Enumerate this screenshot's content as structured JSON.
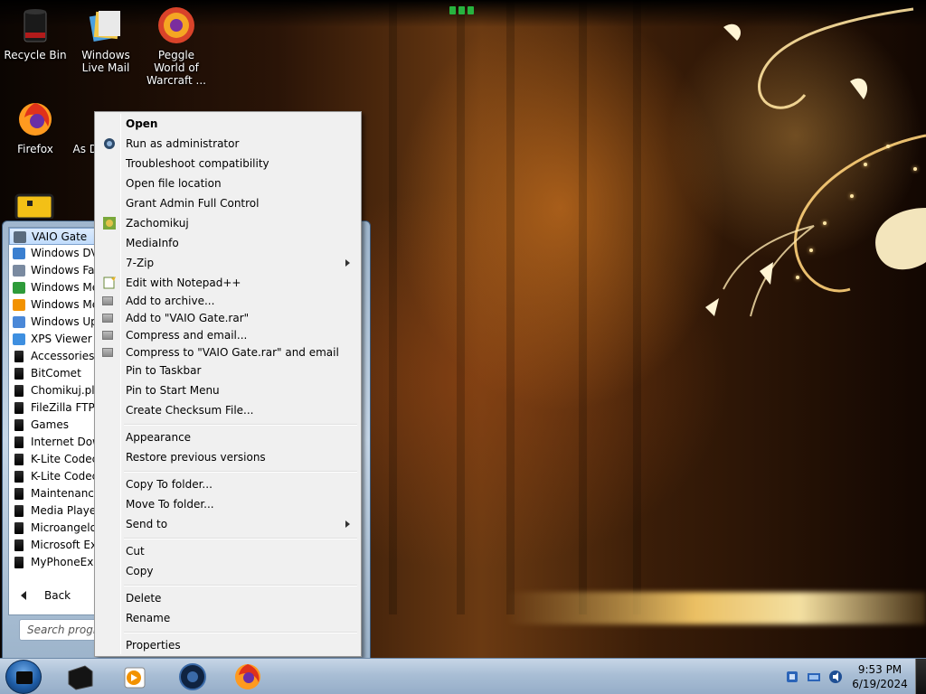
{
  "desktop": {
    "icons": [
      {
        "label": "Recycle Bin",
        "icon": "recycle-bin-icon"
      },
      {
        "label": "Windows Live Mail",
        "icon": "windows-live-mail-icon"
      },
      {
        "label": "Peggle World of Warcraft ...",
        "icon": "peggle-icon"
      },
      {
        "label": "Firefox",
        "icon": "firefox-icon"
      },
      {
        "label": "As D",
        "icon": "partial-icon"
      }
    ]
  },
  "start_menu": {
    "programs": [
      {
        "label": "VAIO Gate",
        "icon": "vaio-gate-icon",
        "selected": true
      },
      {
        "label": "Windows DVD",
        "icon": "windows-dvd-icon"
      },
      {
        "label": "Windows Fax",
        "icon": "windows-fax-icon"
      },
      {
        "label": "Windows Me",
        "icon": "windows-media-center-icon"
      },
      {
        "label": "Windows Me",
        "icon": "windows-media-player-icon"
      },
      {
        "label": "Windows Upo",
        "icon": "windows-update-icon"
      },
      {
        "label": "XPS Viewer",
        "icon": "xps-viewer-icon"
      },
      {
        "label": "Accessories",
        "icon": "folder-icon"
      },
      {
        "label": "BitComet",
        "icon": "folder-icon"
      },
      {
        "label": "Chomikuj.pl",
        "icon": "folder-icon"
      },
      {
        "label": "FileZilla FTP C",
        "icon": "folder-icon"
      },
      {
        "label": "Games",
        "icon": "folder-icon"
      },
      {
        "label": "Internet Dowr",
        "icon": "folder-icon"
      },
      {
        "label": "K-Lite Codec",
        "icon": "folder-icon"
      },
      {
        "label": "K-Lite Codec",
        "icon": "folder-icon"
      },
      {
        "label": "Maintenance",
        "icon": "folder-icon"
      },
      {
        "label": "Media Player",
        "icon": "folder-icon"
      },
      {
        "label": "Microangelo",
        "icon": "folder-icon"
      },
      {
        "label": "Microsoft Exp",
        "icon": "folder-icon"
      },
      {
        "label": "MyPhoneExpl",
        "icon": "folder-icon"
      }
    ],
    "back_label": "Back",
    "search_placeholder": "Search progra"
  },
  "context_menu": {
    "items": [
      {
        "label": "Open",
        "bold": true,
        "icon": null
      },
      {
        "label": "Run as administrator",
        "icon": "shield-icon"
      },
      {
        "label": "Troubleshoot compatibility",
        "icon": null
      },
      {
        "label": "Open file location",
        "icon": null
      },
      {
        "label": "Grant Admin Full Control",
        "icon": null
      },
      {
        "label": "Zachomikuj",
        "icon": "chomikuj-icon"
      },
      {
        "label": "MediaInfo",
        "icon": null
      },
      {
        "label": "7-Zip",
        "icon": null,
        "submenu": true
      },
      {
        "label": "Edit with Notepad++",
        "icon": "notepad-plus-icon"
      },
      {
        "label": "Add to archive...",
        "icon": "winrar-icon"
      },
      {
        "label": "Add to \"VAIO Gate.rar\"",
        "icon": "winrar-icon"
      },
      {
        "label": "Compress and email...",
        "icon": "winrar-icon"
      },
      {
        "label": "Compress to \"VAIO Gate.rar\" and email",
        "icon": "winrar-icon"
      },
      {
        "label": "Pin to Taskbar",
        "icon": null
      },
      {
        "label": "Pin to Start Menu",
        "icon": null
      },
      {
        "label": "Create Checksum File...",
        "icon": null
      },
      {
        "label": "Appearance",
        "icon": null
      },
      {
        "label": "Restore previous versions",
        "icon": null
      },
      {
        "label": "Copy To folder...",
        "icon": null
      },
      {
        "label": "Move To folder...",
        "icon": null
      },
      {
        "label": "Send to",
        "icon": null,
        "submenu": true
      },
      {
        "label": "Cut",
        "icon": null
      },
      {
        "label": "Copy",
        "icon": null
      },
      {
        "label": "Delete",
        "icon": null
      },
      {
        "label": "Rename",
        "icon": null
      },
      {
        "label": "Properties",
        "icon": null
      }
    ]
  },
  "taskbar": {
    "pinned": [
      {
        "icon": "vaio-gate-taskbar-icon"
      },
      {
        "icon": "windows-media-player-taskbar-icon"
      },
      {
        "icon": "media-center-taskbar-icon"
      },
      {
        "icon": "firefox-taskbar-icon"
      }
    ],
    "tray_icons": [
      "language-icon",
      "network-icon",
      "volume-icon"
    ],
    "time": "9:53 PM",
    "date": "6/19/2024"
  },
  "colors": {
    "menu_bg": "#f0f0f0",
    "selection": "#c1dcfc",
    "taskbar": "#a9bed5"
  }
}
